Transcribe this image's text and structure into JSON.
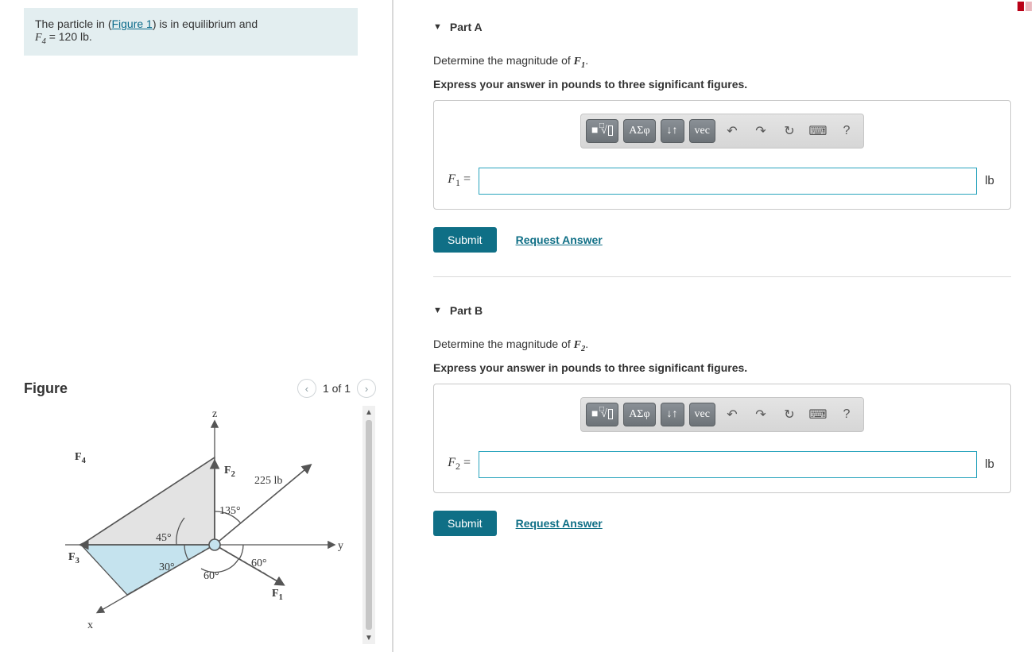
{
  "problem": {
    "text_before_link": "The particle in (",
    "link_text": "Figure 1",
    "text_after_link": ") is in equilibrium and",
    "line2_var": "F",
    "line2_sub": "4",
    "line2_val": " = 120 lb."
  },
  "figure": {
    "title": "Figure",
    "pager": "1 of 1",
    "labels": {
      "z": "z",
      "y": "y",
      "x": "x",
      "F1": "F",
      "F1sub": "1",
      "F2": "F",
      "F2sub": "2",
      "F3": "F",
      "F3sub": "3",
      "F4": "F",
      "F4sub": "4",
      "v225": "225 lb",
      "a135": "135°",
      "a60a": "60°",
      "a60b": "60°",
      "a30": "30°",
      "a45": "45°"
    }
  },
  "parts": [
    {
      "header": "Part A",
      "prompt_pre": "Determine the magnitude of ",
      "prompt_var": "F",
      "prompt_sub": "1",
      "prompt_post": ".",
      "hint": "Express your answer in pounds to three significant figures.",
      "toolbar": {
        "templates": "□",
        "sqrt": "√",
        "greek": "ΑΣφ",
        "sort": "↓↑",
        "vec": "vec",
        "undo": "↶",
        "redo": "↷",
        "reset": "↻",
        "kbd": "⌨",
        "help": "?"
      },
      "lhs_var": "F",
      "lhs_sub": "1",
      "lhs_eq": " =",
      "unit": "lb",
      "submit": "Submit",
      "request": "Request Answer"
    },
    {
      "header": "Part B",
      "prompt_pre": "Determine the magnitude of ",
      "prompt_var": "F",
      "prompt_sub": "2",
      "prompt_post": ".",
      "hint": "Express your answer in pounds to three significant figures.",
      "toolbar": {
        "templates": "□",
        "sqrt": "√",
        "greek": "ΑΣφ",
        "sort": "↓↑",
        "vec": "vec",
        "undo": "↶",
        "redo": "↷",
        "reset": "↻",
        "kbd": "⌨",
        "help": "?"
      },
      "lhs_var": "F",
      "lhs_sub": "2",
      "lhs_eq": " =",
      "unit": "lb",
      "submit": "Submit",
      "request": "Request Answer"
    }
  ]
}
